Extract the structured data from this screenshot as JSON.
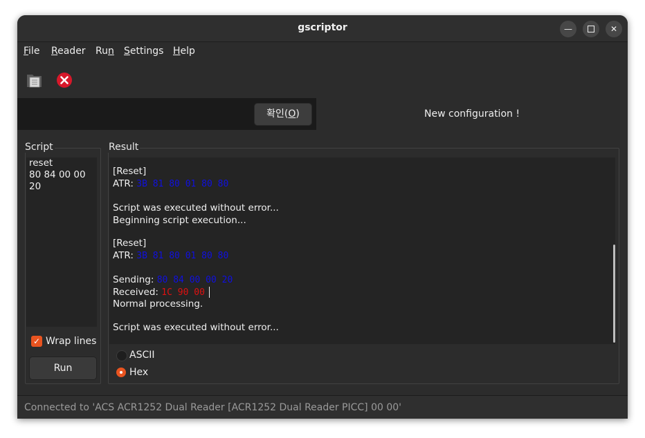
{
  "window": {
    "title": "gscriptor",
    "controls": [
      "minimize",
      "maximize",
      "close"
    ]
  },
  "menu": [
    {
      "label": "File",
      "mnemonic": "F",
      "rest": "ile"
    },
    {
      "label": "Reader",
      "mnemonic": "R",
      "rest": "eader"
    },
    {
      "pre": "Ru",
      "mnemonic": "n",
      "label": "Run"
    },
    {
      "label": "Settings",
      "mnemonic": "S",
      "rest": "ettings"
    },
    {
      "label": "Help",
      "mnemonic": "H",
      "rest": "elp"
    }
  ],
  "toolbar": {
    "open_icon": "folder-document-icon",
    "stop_icon": "stop-close-icon"
  },
  "infobar": {
    "ok_label_pre": "확인(",
    "ok_mnemonic": "O",
    "ok_label_post": ")",
    "message": "New configuration !"
  },
  "script_panel": {
    "label": "Script",
    "lines": [
      "reset",
      "80 84 00 00 20"
    ],
    "wrap_label": "Wrap lines",
    "wrap_checked": true,
    "run_label": "Run"
  },
  "result_panel": {
    "label": "Result",
    "reset1": "[Reset]",
    "atr_label": "ATR:",
    "atr_value": "3B 81 80 01 80 80",
    "done1": "Script was executed without error...",
    "begin": "Beginning script execution...",
    "reset2": "[Reset]",
    "atr2_label": "ATR:",
    "atr2_value": "3B 81 80 01 80 80",
    "sending_label": "Sending:",
    "sending_value": "80 84 00 00 20",
    "received_label": "Received:",
    "received_value": "1C 90 00",
    "normal": "Normal processing.",
    "done2": "Script was executed without error...",
    "modes": [
      {
        "label": "ASCII",
        "selected": false
      },
      {
        "label": "Hex",
        "selected": true
      }
    ]
  },
  "statusbar": {
    "text": "Connected to 'ACS ACR1252 Dual Reader [ACR1252 Dual Reader PICC] 00 00'"
  },
  "colors": {
    "accent": "#e95420",
    "sent_hex": "#1010e0",
    "received_hex": "#e01010"
  }
}
